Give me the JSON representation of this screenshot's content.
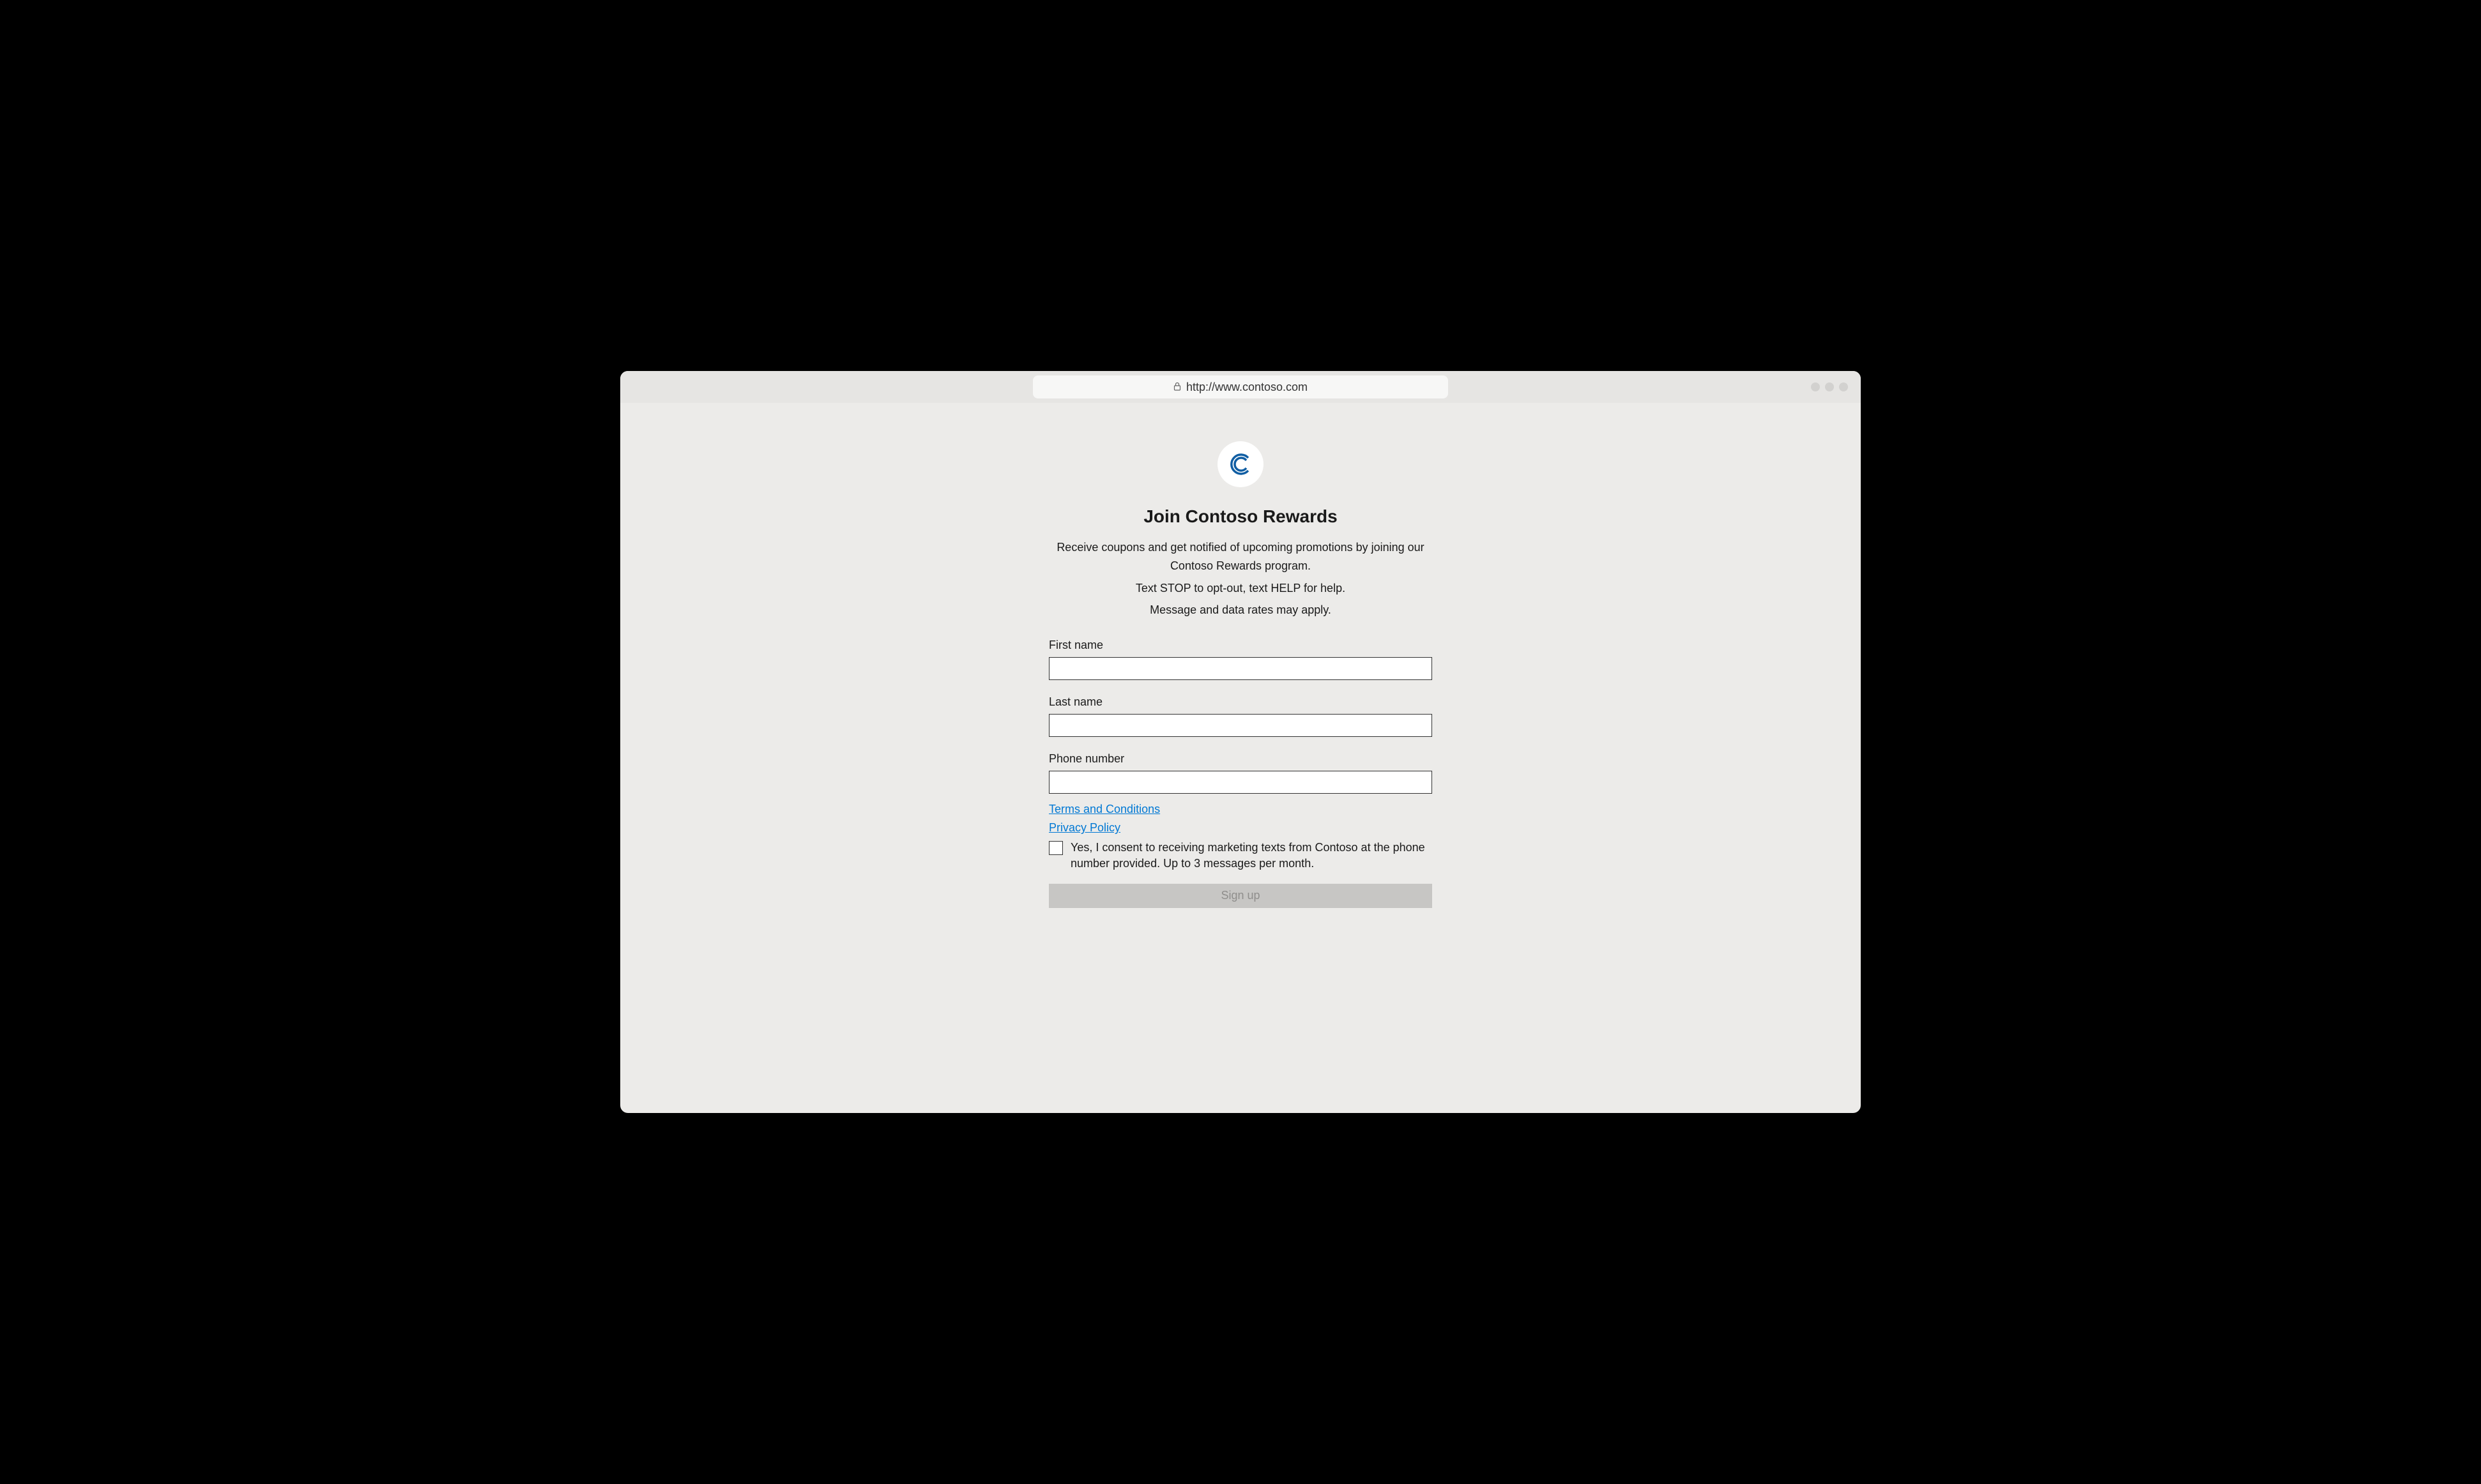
{
  "browser": {
    "url": "http://www.contoso.com"
  },
  "page": {
    "title": "Join Contoso Rewards",
    "description_line1": "Receive coupons and get notified of upcoming promotions by joining our Contoso Rewards program.",
    "description_line2": "Text STOP to opt-out, text HELP for help.",
    "description_line3": "Message and data rates may apply."
  },
  "form": {
    "first_name_label": "First name",
    "first_name_value": "",
    "last_name_label": "Last name",
    "last_name_value": "",
    "phone_label": "Phone number",
    "phone_value": "",
    "terms_link": "Terms and Conditions",
    "privacy_link": "Privacy Policy",
    "consent_text": "Yes, I consent to receiving marketing texts from Contoso at the phone number provided. Up to 3 messages per month.",
    "submit_label": "Sign up"
  },
  "colors": {
    "link_blue": "#0078d4",
    "logo_blue": "#115ea3"
  }
}
